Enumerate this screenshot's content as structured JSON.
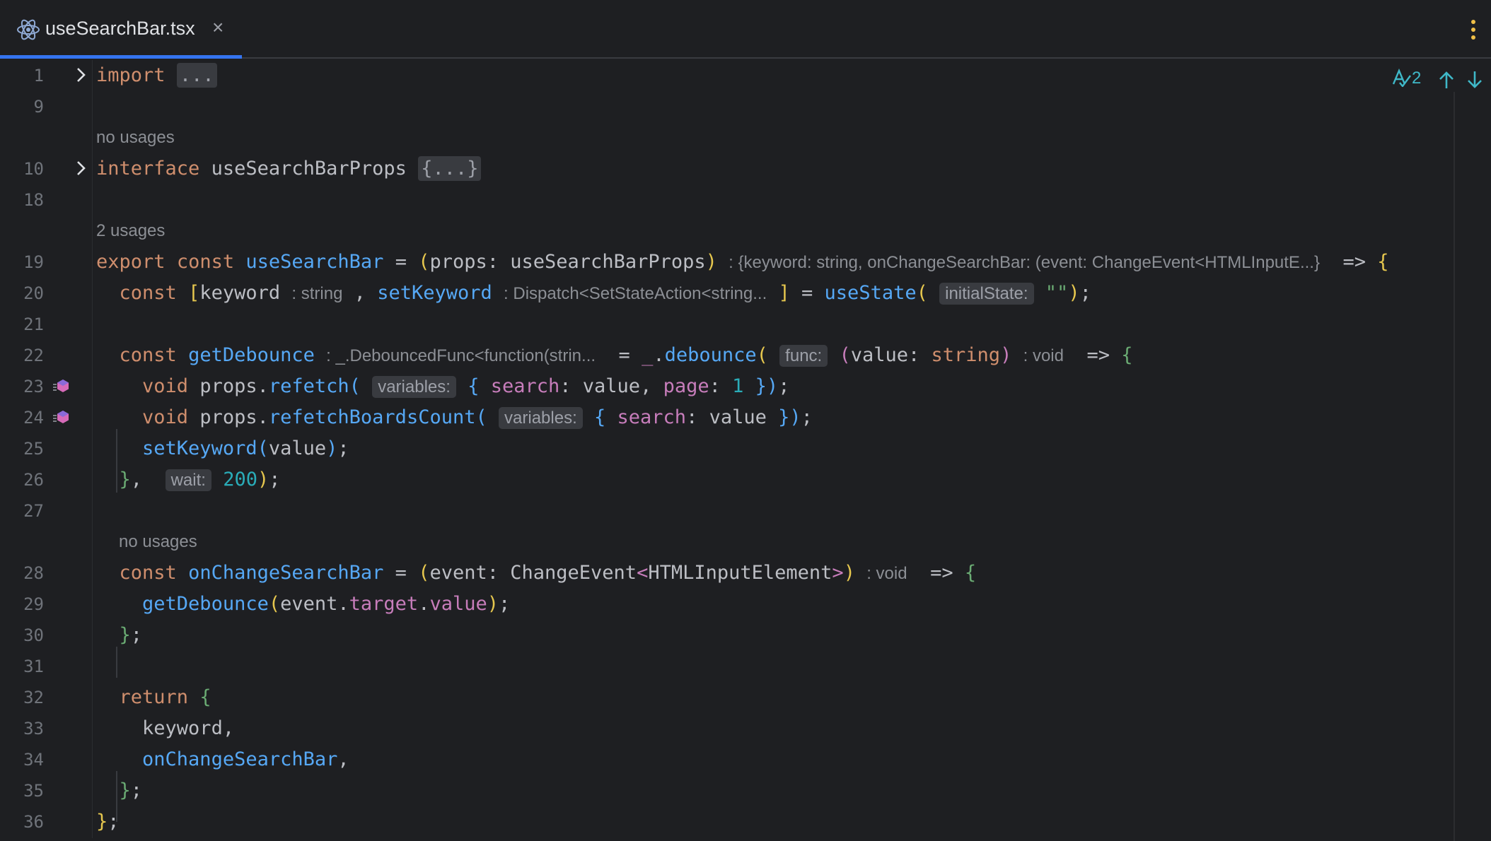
{
  "tab": {
    "title": "useSearchBar.tsx",
    "close_label": "×",
    "icon": "react-icon"
  },
  "toolbar": {
    "more_icon": "more-vertical-icon"
  },
  "inspections": {
    "typo_count": "2",
    "typo_icon": "typo-icon",
    "prev_icon": "arrow-up-icon",
    "next_icon": "arrow-down-icon"
  },
  "lines": {
    "l1": "1",
    "l9": "9",
    "l10": "10",
    "l18": "18",
    "l19": "19",
    "l20": "20",
    "l21": "21",
    "l22": "22",
    "l23": "23",
    "l24": "24",
    "l25": "25",
    "l26": "26",
    "l27": "27",
    "l28": "28",
    "l29": "29",
    "l30": "30",
    "l31": "31",
    "l32": "32",
    "l33": "33",
    "l34": "34",
    "l35": "35",
    "l36": "36"
  },
  "lens": {
    "no_usages_1": "no usages",
    "two_usages": "2 usages",
    "no_usages_2": "no usages"
  },
  "code": {
    "import_kw": "import",
    "import_fold": "...",
    "interface_kw": "interface",
    "interface_name": "useSearchBarProps",
    "interface_fold": "{...}",
    "export_kw": "export",
    "const_kw": "const",
    "hook_name": "useSearchBar",
    "eq": " = ",
    "props_param": "props: useSearchBarProps",
    "return_hint": ": {keyword: string, onChangeSearchBar: (event: ChangeEvent<HTMLInputE...}",
    "arrow": "=>",
    "open_brace": "{",
    "keyword_var": "keyword",
    "keyword_hint": ": string",
    "set_keyword": "setKeyword",
    "set_keyword_hint": ": Dispatch<SetStateAction<string...",
    "use_state": "useState",
    "initial_state_hint": "initialState:",
    "empty_string": "\"\"",
    "get_debounce": "getDebounce",
    "debounce_hint": ": _.DebouncedFunc<function(strin...",
    "lodash": "_",
    "debounce_fn": "debounce",
    "func_hint": "func:",
    "value_param": "value",
    "string_type": "string",
    "void_hint": ": void",
    "void_kw": "void",
    "props_obj": "props",
    "refetch": "refetch",
    "variables_hint": "variables:",
    "search_key": "search",
    "value_word": "value",
    "page_key": "page",
    "one": "1",
    "refetch_boards": "refetchBoardsCount",
    "wait_hint": "wait:",
    "wait_value": "200",
    "on_change": "onChangeSearchBar",
    "event_param": "event: ChangeEvent",
    "html_input": "HTMLInputElement",
    "event_obj": "event",
    "target": "target",
    "return_kw": "return"
  }
}
